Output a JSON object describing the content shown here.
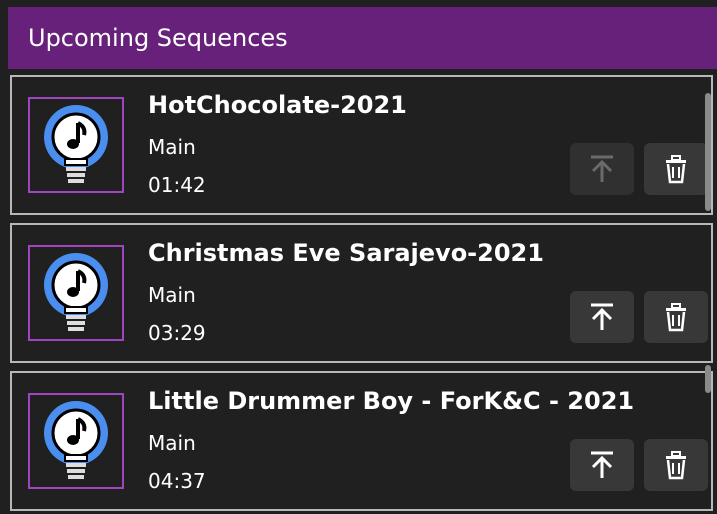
{
  "header": {
    "title": "Upcoming Sequences"
  },
  "sequences": [
    {
      "title": "HotChocolate-2021",
      "playlist": "Main",
      "duration": "01:42",
      "move_to_top_enabled": false,
      "icon": "bulb-note-icon"
    },
    {
      "title": "Christmas Eve Sarajevo-2021",
      "playlist": "Main",
      "duration": "03:29",
      "move_to_top_enabled": true,
      "icon": "bulb-note-icon"
    },
    {
      "title": "Little Drummer Boy - ForK&C - 2021",
      "playlist": "Main",
      "duration": "04:37",
      "move_to_top_enabled": true,
      "icon": "bulb-note-icon"
    }
  ],
  "colors": {
    "header_bg": "#68217a",
    "card_border": "#b8b8b8",
    "thumb_border": "#a044c0",
    "bulb_blue": "#4a8ff0"
  }
}
